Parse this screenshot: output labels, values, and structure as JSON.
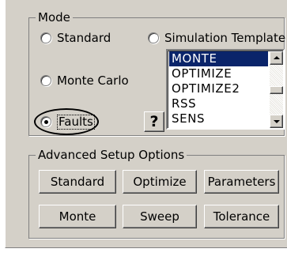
{
  "mode_group": {
    "title": "Mode",
    "radios": {
      "standard": "Standard",
      "simulation_template": "Simulation Template",
      "monte_carlo": "Monte Carlo",
      "faults": "Faults"
    },
    "selected": "Faults"
  },
  "help_button": {
    "label": "?"
  },
  "template_list": {
    "items": [
      "MONTE",
      "OPTIMIZE",
      "OPTIMIZE2",
      "RSS",
      "SENS"
    ],
    "selected": "MONTE"
  },
  "advanced_group": {
    "title": "Advanced Setup Options",
    "buttons": {
      "standard": "Standard",
      "optimize": "Optimize",
      "parameters": "Parameters",
      "monte": "Monte",
      "sweep": "Sweep",
      "tolerance": "Tolerance"
    }
  },
  "colors": {
    "dialog_bg": "#d4d0c8",
    "selection_bg": "#0a246a",
    "selection_text": "#ffffff"
  }
}
